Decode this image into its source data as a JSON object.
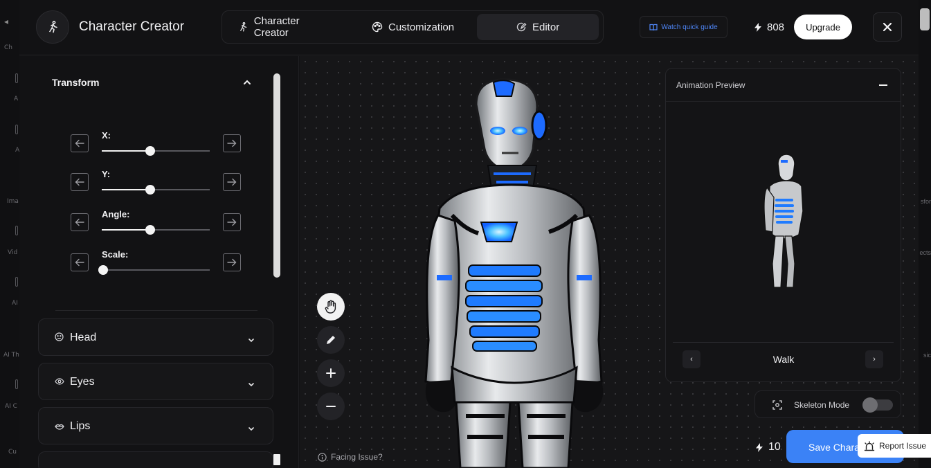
{
  "header": {
    "app_title": "Character Creator",
    "tabs": [
      {
        "label": "Character Creator",
        "icon": "running-figure-icon",
        "active": false
      },
      {
        "label": "Customization",
        "icon": "palette-icon",
        "active": false
      },
      {
        "label": "Editor",
        "icon": "edit-circle-icon",
        "active": true
      }
    ],
    "guide_label": "Watch quick guide",
    "credits": "808",
    "upgrade_label": "Upgrade"
  },
  "transform": {
    "title": "Transform",
    "controls": [
      {
        "label": "X:",
        "level": 0.45
      },
      {
        "label": "Y:",
        "level": 0.45
      },
      {
        "label": "Angle:",
        "level": 0.45
      },
      {
        "label": "Scale:",
        "level": 0.0
      }
    ]
  },
  "accordions": [
    {
      "label": "Head",
      "icon": "face-icon"
    },
    {
      "label": "Eyes",
      "icon": "eye-icon"
    },
    {
      "label": "Lips",
      "icon": "lips-icon"
    }
  ],
  "canvas": {
    "tools": [
      "hand-icon",
      "pencil-icon",
      "plus-icon",
      "minus-icon"
    ],
    "facing_issue": "Facing Issue?"
  },
  "preview": {
    "title": "Animation Preview",
    "animation": "Walk",
    "prev_glyph": "‹",
    "next_glyph": "›"
  },
  "skeleton": {
    "label": "Skeleton Mode",
    "enabled": false
  },
  "footer": {
    "cost": "10",
    "save_label": "Save Character",
    "report_label": "Report Issue"
  },
  "background_labels": [
    "Ch",
    "A",
    "A",
    "Ima",
    "Vid",
    "AI",
    "AI Th",
    "AI C",
    "Cu"
  ],
  "background_right_labels": [
    "sfor",
    "ects",
    "sic"
  ],
  "colors": {
    "accent": "#3b82f6",
    "guide": "#4f86f7",
    "panel": "#121214"
  }
}
